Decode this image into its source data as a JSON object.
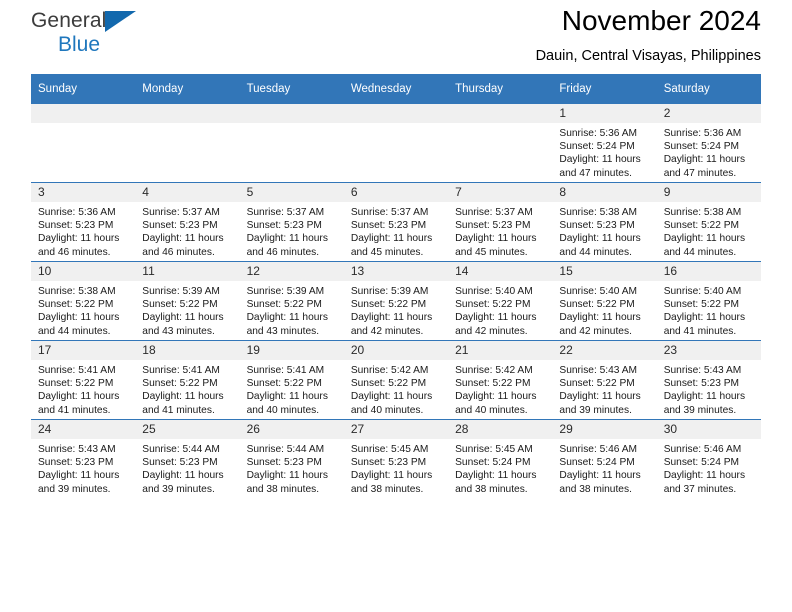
{
  "brand": {
    "name_part1": "General",
    "name_part2": "Blue",
    "accent_color": "#1268ad"
  },
  "header": {
    "title": "November 2024",
    "location": "Dauin, Central Visayas, Philippines",
    "header_bg_color": "#3276b8",
    "daynum_bg_color": "#f0f0f0"
  },
  "weekdays": [
    "Sunday",
    "Monday",
    "Tuesday",
    "Wednesday",
    "Thursday",
    "Friday",
    "Saturday"
  ],
  "weeks": [
    [
      {
        "day": "",
        "sunrise": "",
        "sunset": "",
        "daylight_line1": "",
        "daylight_line2": "",
        "empty": true
      },
      {
        "day": "",
        "sunrise": "",
        "sunset": "",
        "daylight_line1": "",
        "daylight_line2": "",
        "empty": true
      },
      {
        "day": "",
        "sunrise": "",
        "sunset": "",
        "daylight_line1": "",
        "daylight_line2": "",
        "empty": true
      },
      {
        "day": "",
        "sunrise": "",
        "sunset": "",
        "daylight_line1": "",
        "daylight_line2": "",
        "empty": true
      },
      {
        "day": "",
        "sunrise": "",
        "sunset": "",
        "daylight_line1": "",
        "daylight_line2": "",
        "empty": true
      },
      {
        "day": "1",
        "sunrise": "Sunrise: 5:36 AM",
        "sunset": "Sunset: 5:24 PM",
        "daylight_line1": "Daylight: 11 hours",
        "daylight_line2": "and 47 minutes."
      },
      {
        "day": "2",
        "sunrise": "Sunrise: 5:36 AM",
        "sunset": "Sunset: 5:24 PM",
        "daylight_line1": "Daylight: 11 hours",
        "daylight_line2": "and 47 minutes."
      }
    ],
    [
      {
        "day": "3",
        "sunrise": "Sunrise: 5:36 AM",
        "sunset": "Sunset: 5:23 PM",
        "daylight_line1": "Daylight: 11 hours",
        "daylight_line2": "and 46 minutes."
      },
      {
        "day": "4",
        "sunrise": "Sunrise: 5:37 AM",
        "sunset": "Sunset: 5:23 PM",
        "daylight_line1": "Daylight: 11 hours",
        "daylight_line2": "and 46 minutes."
      },
      {
        "day": "5",
        "sunrise": "Sunrise: 5:37 AM",
        "sunset": "Sunset: 5:23 PM",
        "daylight_line1": "Daylight: 11 hours",
        "daylight_line2": "and 46 minutes."
      },
      {
        "day": "6",
        "sunrise": "Sunrise: 5:37 AM",
        "sunset": "Sunset: 5:23 PM",
        "daylight_line1": "Daylight: 11 hours",
        "daylight_line2": "and 45 minutes."
      },
      {
        "day": "7",
        "sunrise": "Sunrise: 5:37 AM",
        "sunset": "Sunset: 5:23 PM",
        "daylight_line1": "Daylight: 11 hours",
        "daylight_line2": "and 45 minutes."
      },
      {
        "day": "8",
        "sunrise": "Sunrise: 5:38 AM",
        "sunset": "Sunset: 5:23 PM",
        "daylight_line1": "Daylight: 11 hours",
        "daylight_line2": "and 44 minutes."
      },
      {
        "day": "9",
        "sunrise": "Sunrise: 5:38 AM",
        "sunset": "Sunset: 5:22 PM",
        "daylight_line1": "Daylight: 11 hours",
        "daylight_line2": "and 44 minutes."
      }
    ],
    [
      {
        "day": "10",
        "sunrise": "Sunrise: 5:38 AM",
        "sunset": "Sunset: 5:22 PM",
        "daylight_line1": "Daylight: 11 hours",
        "daylight_line2": "and 44 minutes."
      },
      {
        "day": "11",
        "sunrise": "Sunrise: 5:39 AM",
        "sunset": "Sunset: 5:22 PM",
        "daylight_line1": "Daylight: 11 hours",
        "daylight_line2": "and 43 minutes."
      },
      {
        "day": "12",
        "sunrise": "Sunrise: 5:39 AM",
        "sunset": "Sunset: 5:22 PM",
        "daylight_line1": "Daylight: 11 hours",
        "daylight_line2": "and 43 minutes."
      },
      {
        "day": "13",
        "sunrise": "Sunrise: 5:39 AM",
        "sunset": "Sunset: 5:22 PM",
        "daylight_line1": "Daylight: 11 hours",
        "daylight_line2": "and 42 minutes."
      },
      {
        "day": "14",
        "sunrise": "Sunrise: 5:40 AM",
        "sunset": "Sunset: 5:22 PM",
        "daylight_line1": "Daylight: 11 hours",
        "daylight_line2": "and 42 minutes."
      },
      {
        "day": "15",
        "sunrise": "Sunrise: 5:40 AM",
        "sunset": "Sunset: 5:22 PM",
        "daylight_line1": "Daylight: 11 hours",
        "daylight_line2": "and 42 minutes."
      },
      {
        "day": "16",
        "sunrise": "Sunrise: 5:40 AM",
        "sunset": "Sunset: 5:22 PM",
        "daylight_line1": "Daylight: 11 hours",
        "daylight_line2": "and 41 minutes."
      }
    ],
    [
      {
        "day": "17",
        "sunrise": "Sunrise: 5:41 AM",
        "sunset": "Sunset: 5:22 PM",
        "daylight_line1": "Daylight: 11 hours",
        "daylight_line2": "and 41 minutes."
      },
      {
        "day": "18",
        "sunrise": "Sunrise: 5:41 AM",
        "sunset": "Sunset: 5:22 PM",
        "daylight_line1": "Daylight: 11 hours",
        "daylight_line2": "and 41 minutes."
      },
      {
        "day": "19",
        "sunrise": "Sunrise: 5:41 AM",
        "sunset": "Sunset: 5:22 PM",
        "daylight_line1": "Daylight: 11 hours",
        "daylight_line2": "and 40 minutes."
      },
      {
        "day": "20",
        "sunrise": "Sunrise: 5:42 AM",
        "sunset": "Sunset: 5:22 PM",
        "daylight_line1": "Daylight: 11 hours",
        "daylight_line2": "and 40 minutes."
      },
      {
        "day": "21",
        "sunrise": "Sunrise: 5:42 AM",
        "sunset": "Sunset: 5:22 PM",
        "daylight_line1": "Daylight: 11 hours",
        "daylight_line2": "and 40 minutes."
      },
      {
        "day": "22",
        "sunrise": "Sunrise: 5:43 AM",
        "sunset": "Sunset: 5:22 PM",
        "daylight_line1": "Daylight: 11 hours",
        "daylight_line2": "and 39 minutes."
      },
      {
        "day": "23",
        "sunrise": "Sunrise: 5:43 AM",
        "sunset": "Sunset: 5:23 PM",
        "daylight_line1": "Daylight: 11 hours",
        "daylight_line2": "and 39 minutes."
      }
    ],
    [
      {
        "day": "24",
        "sunrise": "Sunrise: 5:43 AM",
        "sunset": "Sunset: 5:23 PM",
        "daylight_line1": "Daylight: 11 hours",
        "daylight_line2": "and 39 minutes."
      },
      {
        "day": "25",
        "sunrise": "Sunrise: 5:44 AM",
        "sunset": "Sunset: 5:23 PM",
        "daylight_line1": "Daylight: 11 hours",
        "daylight_line2": "and 39 minutes."
      },
      {
        "day": "26",
        "sunrise": "Sunrise: 5:44 AM",
        "sunset": "Sunset: 5:23 PM",
        "daylight_line1": "Daylight: 11 hours",
        "daylight_line2": "and 38 minutes."
      },
      {
        "day": "27",
        "sunrise": "Sunrise: 5:45 AM",
        "sunset": "Sunset: 5:23 PM",
        "daylight_line1": "Daylight: 11 hours",
        "daylight_line2": "and 38 minutes."
      },
      {
        "day": "28",
        "sunrise": "Sunrise: 5:45 AM",
        "sunset": "Sunset: 5:24 PM",
        "daylight_line1": "Daylight: 11 hours",
        "daylight_line2": "and 38 minutes."
      },
      {
        "day": "29",
        "sunrise": "Sunrise: 5:46 AM",
        "sunset": "Sunset: 5:24 PM",
        "daylight_line1": "Daylight: 11 hours",
        "daylight_line2": "and 38 minutes."
      },
      {
        "day": "30",
        "sunrise": "Sunrise: 5:46 AM",
        "sunset": "Sunset: 5:24 PM",
        "daylight_line1": "Daylight: 11 hours",
        "daylight_line2": "and 37 minutes."
      }
    ]
  ]
}
